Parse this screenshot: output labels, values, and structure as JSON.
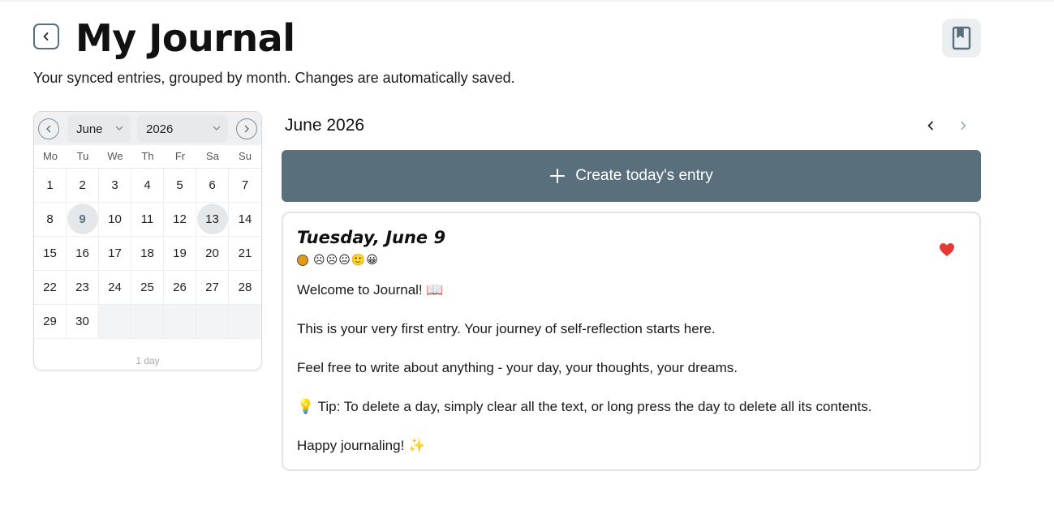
{
  "header": {
    "title": "My Journal",
    "subtitle": "Your synced entries, grouped by month. Changes are automatically saved.",
    "back_icon": "chevron-left-icon",
    "bookmark_icon": "bookmark-book-icon"
  },
  "calendar": {
    "month": "June",
    "year": "2026",
    "weekdays": [
      "Mo",
      "Tu",
      "We",
      "Th",
      "Fr",
      "Sa",
      "Su"
    ],
    "weeks": [
      [
        "1",
        "2",
        "3",
        "4",
        "5",
        "6",
        "7"
      ],
      [
        "8",
        "9",
        "10",
        "11",
        "12",
        "13",
        "14"
      ],
      [
        "15",
        "16",
        "17",
        "18",
        "19",
        "20",
        "21"
      ],
      [
        "22",
        "23",
        "24",
        "25",
        "26",
        "27",
        "28"
      ],
      [
        "29",
        "30",
        "",
        "",
        "",
        "",
        ""
      ]
    ],
    "highlighted_days": [
      "9",
      "13"
    ],
    "today": "9",
    "footer": "1 day"
  },
  "month_view": {
    "title": "June 2026",
    "create_label": "Create today's entry"
  },
  "entry": {
    "date": "Tuesday, June 9",
    "favorite": true,
    "mood_color": "#e39a10",
    "moods": [
      "☹",
      "☹",
      "😐",
      "🙂",
      "😀"
    ],
    "paragraphs": [
      "Welcome to Journal! 📖",
      "This is your very first entry. Your journey of self-reflection starts here.",
      "Feel free to write about anything - your day, your thoughts, your dreams.",
      "💡 Tip: To delete a day, simply clear all the text, or long press the day to delete all its contents.",
      "Happy journaling! ✨"
    ]
  },
  "colors": {
    "accent": "#5a6f7c",
    "heart": "#e53935"
  }
}
